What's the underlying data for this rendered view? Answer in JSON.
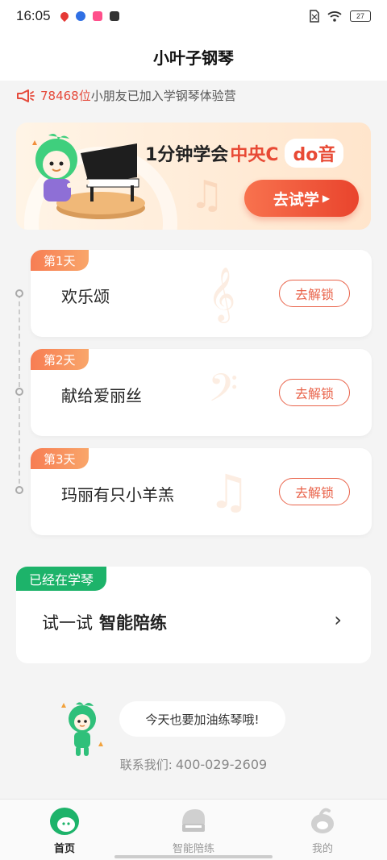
{
  "status_bar": {
    "time": "16:05",
    "battery": "27",
    "icons": [
      "location-icon",
      "baidu-icon",
      "app-icon",
      "media-icon",
      "no-sim-icon",
      "wifi-icon",
      "battery-icon"
    ]
  },
  "header": {
    "title": "小叶子钢琴"
  },
  "notice": {
    "count": "78468位",
    "text": "小朋友已加入学钢琴体验营"
  },
  "banner": {
    "title_prefix": "1分钟学会",
    "title_highlight": "中央C",
    "title_badge": "do音",
    "button_label": "去试学"
  },
  "lessons": [
    {
      "day": "第1天",
      "title": "欢乐颂",
      "button": "去解锁"
    },
    {
      "day": "第2天",
      "title": "献给爱丽丝",
      "button": "去解锁"
    },
    {
      "day": "第3天",
      "title": "玛丽有只小羊羔",
      "button": "去解锁"
    }
  ],
  "practice": {
    "tag": "已经在学琴",
    "prefix": "试一试",
    "emphasis": "智能陪练"
  },
  "mascot_bubble": "今天也要加油练琴哦!",
  "contact": {
    "label": "联系我们:",
    "phone": "400-029-2609"
  },
  "bottom_nav": [
    {
      "label": "首页",
      "active": true
    },
    {
      "label": "智能陪练",
      "active": false
    },
    {
      "label": "我的",
      "active": false
    }
  ],
  "colors": {
    "accent": "#e9442d",
    "green": "#1db36a",
    "orange_tag": "#f77d53"
  }
}
